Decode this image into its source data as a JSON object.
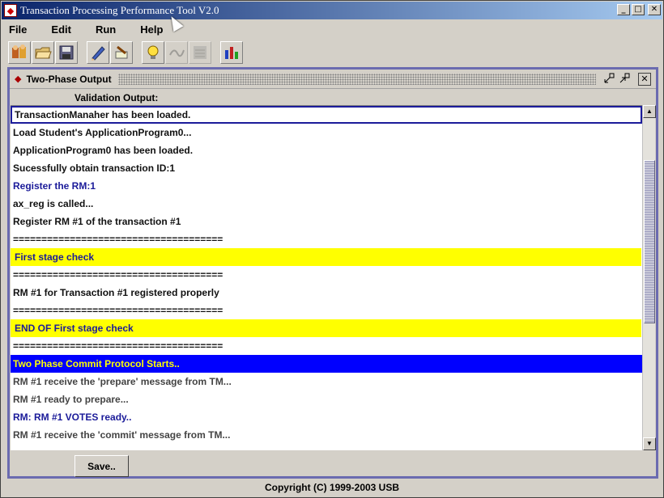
{
  "window": {
    "title": "Transaction Processing Performance Tool V2.0",
    "controls": [
      "_",
      "□",
      "✕"
    ]
  },
  "menu": [
    "File",
    "Edit",
    "Run",
    "Help"
  ],
  "toolbar": {
    "icons": [
      "open-people-icon",
      "open-folder-icon",
      "save-disk-icon",
      "edit-pen-icon",
      "clear-brush-icon",
      "lightbulb-icon",
      "wire-icon",
      "network-icon",
      "chart-icon"
    ]
  },
  "frame": {
    "title": "Two-Phase Output",
    "section_label": "Validation Output:",
    "save_label": "Save.."
  },
  "output_lines": [
    {
      "text": "TransactionManaher has been loaded.",
      "style": "black selected"
    },
    {
      "text": "Load Student's ApplicationProgram0...",
      "style": "black"
    },
    {
      "text": "ApplicationProgram0 has been loaded.",
      "style": "black"
    },
    {
      "text": "Sucessfully obtain transaction ID:1",
      "style": "black"
    },
    {
      "text": "Register the RM:1",
      "style": "blue"
    },
    {
      "text": "ax_reg is called...",
      "style": "black"
    },
    {
      "text": "Register RM #1 of the transaction #1",
      "style": "black"
    },
    {
      "text": "=====================================",
      "style": "black"
    },
    {
      "text": "First stage check",
      "style": "yellow"
    },
    {
      "text": "=====================================",
      "style": "black"
    },
    {
      "text": "RM #1 for Transaction #1 registered properly",
      "style": "black"
    },
    {
      "text": "=====================================",
      "style": "black"
    },
    {
      "text": "END OF First stage check",
      "style": "yellow"
    },
    {
      "text": "=====================================",
      "style": "black"
    },
    {
      "text": "Two Phase Commit Protocol Starts..",
      "style": "bluebg"
    },
    {
      "text": "RM #1 receive the 'prepare' message from TM...",
      "style": "gray"
    },
    {
      "text": "RM #1 ready to prepare...",
      "style": "gray"
    },
    {
      "text": "RM: RM #1 VOTES ready..",
      "style": "blue"
    },
    {
      "text": "RM #1 receive the 'commit' message from TM...",
      "style": "gray"
    }
  ],
  "copyright": "Copyright (C) 1999-2003 USB"
}
